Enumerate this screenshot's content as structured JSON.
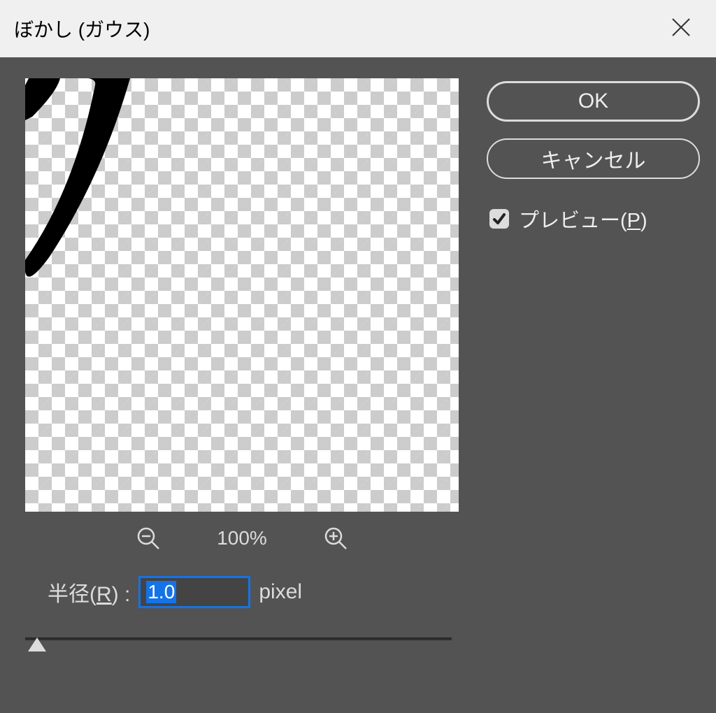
{
  "title": "ぼかし (ガウス)",
  "buttons": {
    "ok": "OK",
    "cancel": "キャンセル"
  },
  "preview": {
    "label_prefix": "プレビュー(",
    "hotkey": "P",
    "label_suffix": ")",
    "checked": true
  },
  "zoom": {
    "level": "100%"
  },
  "radius": {
    "label_prefix": "半径(",
    "hotkey": "R",
    "label_suffix": ") :",
    "value": "1.0",
    "unit": "pixel"
  }
}
